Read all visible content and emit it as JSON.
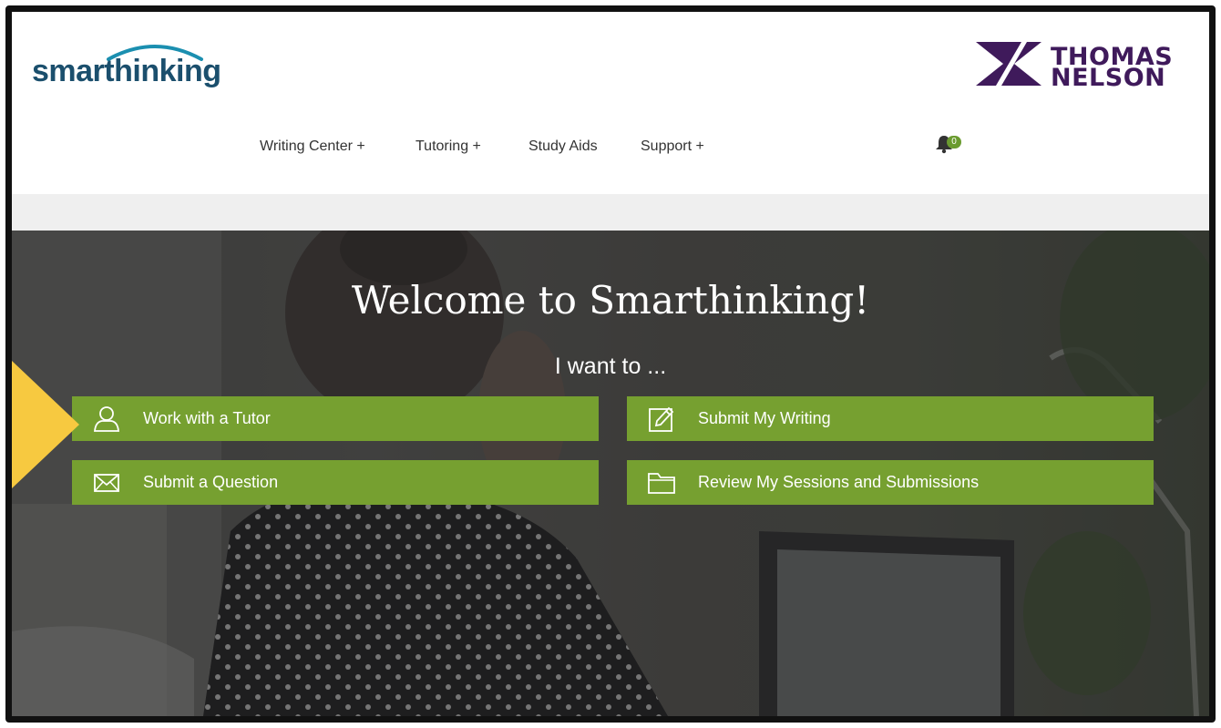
{
  "brand": {
    "logo_text": "smarthinking",
    "partner_line1": "THOMAS",
    "partner_line2": "NELSON"
  },
  "nav": {
    "items": [
      {
        "label": "Writing Center +"
      },
      {
        "label": "Tutoring +"
      },
      {
        "label": "Study Aids"
      },
      {
        "label": "Support +"
      }
    ],
    "notifications": {
      "icon": "bell-icon",
      "count": "0"
    }
  },
  "hero": {
    "title": "Welcome to Smarthinking!",
    "subtitle": "I want to ...",
    "actions": [
      {
        "label": "Work with a Tutor",
        "icon": "user-icon"
      },
      {
        "label": "Submit My Writing",
        "icon": "edit-icon"
      },
      {
        "label": "Submit a Question",
        "icon": "envelope-icon"
      },
      {
        "label": "Review My Sessions and Submissions",
        "icon": "folder-icon"
      }
    ]
  },
  "colors": {
    "brand_teal": "#1b4f6d",
    "partner_purple": "#3f1a5b",
    "action_green": "#76a030",
    "annotation_arrow": "#f7c940"
  }
}
